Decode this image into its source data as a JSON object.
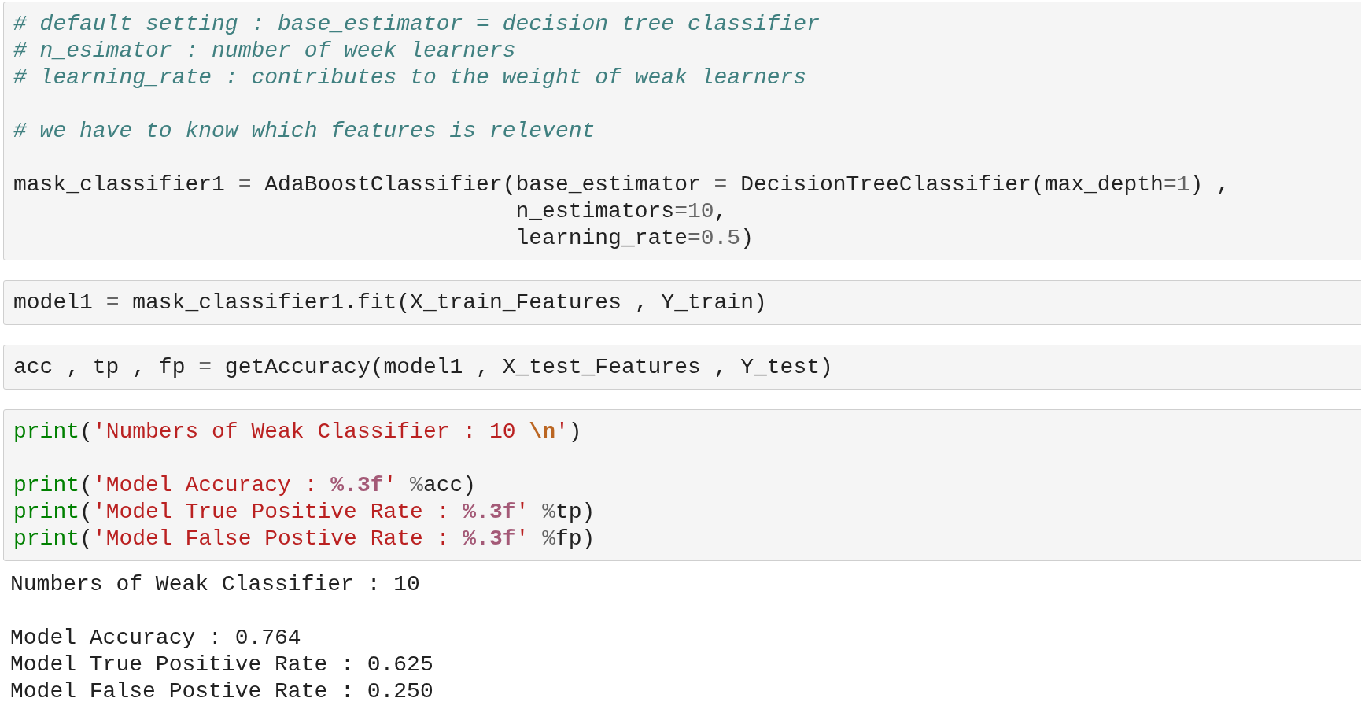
{
  "cells": [
    {
      "kind": "code",
      "paragraphs": [
        {
          "lines": [
            {
              "tokens": [
                {
                  "kind": "comment",
                  "text": "# default setting : base_estimator = decision tree classifier"
                }
              ]
            },
            {
              "tokens": [
                {
                  "kind": "comment",
                  "text": "# n_esimator : number of week learners"
                }
              ]
            },
            {
              "tokens": [
                {
                  "kind": "comment",
                  "text": "# learning_rate : contributes to the weight of weak learners"
                }
              ]
            }
          ]
        },
        {
          "lines": [
            {
              "tokens": [
                {
                  "kind": "comment",
                  "text": "# we have to know which features is relevent"
                }
              ]
            }
          ]
        },
        {
          "lines": [
            {
              "tokens": [
                {
                  "kind": "plain",
                  "text": "mask_classifier1 "
                },
                {
                  "kind": "op",
                  "text": "="
                },
                {
                  "kind": "plain",
                  "text": " AdaBoostClassifier(base_estimator "
                },
                {
                  "kind": "op",
                  "text": "="
                },
                {
                  "kind": "plain",
                  "text": " DecisionTreeClassifier(max_depth"
                },
                {
                  "kind": "op",
                  "text": "="
                },
                {
                  "kind": "number",
                  "text": "1"
                },
                {
                  "kind": "plain",
                  "text": ") ,"
                }
              ]
            },
            {
              "tokens": [
                {
                  "kind": "plain",
                  "text": "                                      n_estimators"
                },
                {
                  "kind": "op",
                  "text": "="
                },
                {
                  "kind": "number",
                  "text": "10"
                },
                {
                  "kind": "plain",
                  "text": ","
                }
              ]
            },
            {
              "tokens": [
                {
                  "kind": "plain",
                  "text": "                                      learning_rate"
                },
                {
                  "kind": "op",
                  "text": "="
                },
                {
                  "kind": "number",
                  "text": "0.5"
                },
                {
                  "kind": "plain",
                  "text": ")"
                }
              ]
            }
          ]
        }
      ]
    },
    {
      "kind": "code",
      "paragraphs": [
        {
          "lines": [
            {
              "tokens": [
                {
                  "kind": "plain",
                  "text": "model1 "
                },
                {
                  "kind": "op",
                  "text": "="
                },
                {
                  "kind": "plain",
                  "text": " mask_classifier1.fit(X_train_Features , Y_train)"
                }
              ]
            }
          ]
        }
      ]
    },
    {
      "kind": "code",
      "paragraphs": [
        {
          "lines": [
            {
              "tokens": [
                {
                  "kind": "plain",
                  "text": "acc , tp , fp "
                },
                {
                  "kind": "op",
                  "text": "="
                },
                {
                  "kind": "plain",
                  "text": " getAccuracy(model1 , X_test_Features , Y_test)"
                }
              ]
            }
          ]
        }
      ]
    },
    {
      "kind": "code",
      "paragraphs": [
        {
          "lines": [
            {
              "tokens": [
                {
                  "kind": "builtin",
                  "text": "print"
                },
                {
                  "kind": "plain",
                  "text": "("
                },
                {
                  "kind": "string",
                  "text": "'Numbers of Weak Classifier : 10 "
                },
                {
                  "kind": "escape",
                  "text": "\\n"
                },
                {
                  "kind": "string",
                  "text": "'"
                },
                {
                  "kind": "plain",
                  "text": ")"
                }
              ]
            }
          ]
        },
        {
          "lines": [
            {
              "tokens": [
                {
                  "kind": "builtin",
                  "text": "print"
                },
                {
                  "kind": "plain",
                  "text": "("
                },
                {
                  "kind": "string",
                  "text": "'Model Accuracy : "
                },
                {
                  "kind": "format",
                  "text": "%.3f"
                },
                {
                  "kind": "string",
                  "text": "'"
                },
                {
                  "kind": "op",
                  "text": " %"
                },
                {
                  "kind": "plain",
                  "text": "acc)"
                }
              ]
            },
            {
              "tokens": [
                {
                  "kind": "builtin",
                  "text": "print"
                },
                {
                  "kind": "plain",
                  "text": "("
                },
                {
                  "kind": "string",
                  "text": "'Model True Positive Rate : "
                },
                {
                  "kind": "format",
                  "text": "%.3f"
                },
                {
                  "kind": "string",
                  "text": "'"
                },
                {
                  "kind": "op",
                  "text": " %"
                },
                {
                  "kind": "plain",
                  "text": "tp)"
                }
              ]
            },
            {
              "tokens": [
                {
                  "kind": "builtin",
                  "text": "print"
                },
                {
                  "kind": "plain",
                  "text": "("
                },
                {
                  "kind": "string",
                  "text": "'Model False Postive Rate : "
                },
                {
                  "kind": "format",
                  "text": "%.3f"
                },
                {
                  "kind": "string",
                  "text": "'"
                },
                {
                  "kind": "op",
                  "text": " %"
                },
                {
                  "kind": "plain",
                  "text": "fp)"
                }
              ]
            }
          ]
        }
      ]
    },
    {
      "kind": "output",
      "paragraphs": [
        {
          "lines": [
            {
              "tokens": [
                {
                  "kind": "plain",
                  "text": "Numbers of Weak Classifier : 10"
                }
              ]
            }
          ]
        },
        {
          "lines": [
            {
              "tokens": [
                {
                  "kind": "plain",
                  "text": "Model Accuracy : 0.764"
                }
              ]
            },
            {
              "tokens": [
                {
                  "kind": "plain",
                  "text": "Model True Positive Rate : 0.625"
                }
              ]
            },
            {
              "tokens": [
                {
                  "kind": "plain",
                  "text": "Model False Postive Rate : 0.250"
                }
              ]
            }
          ]
        }
      ]
    }
  ]
}
